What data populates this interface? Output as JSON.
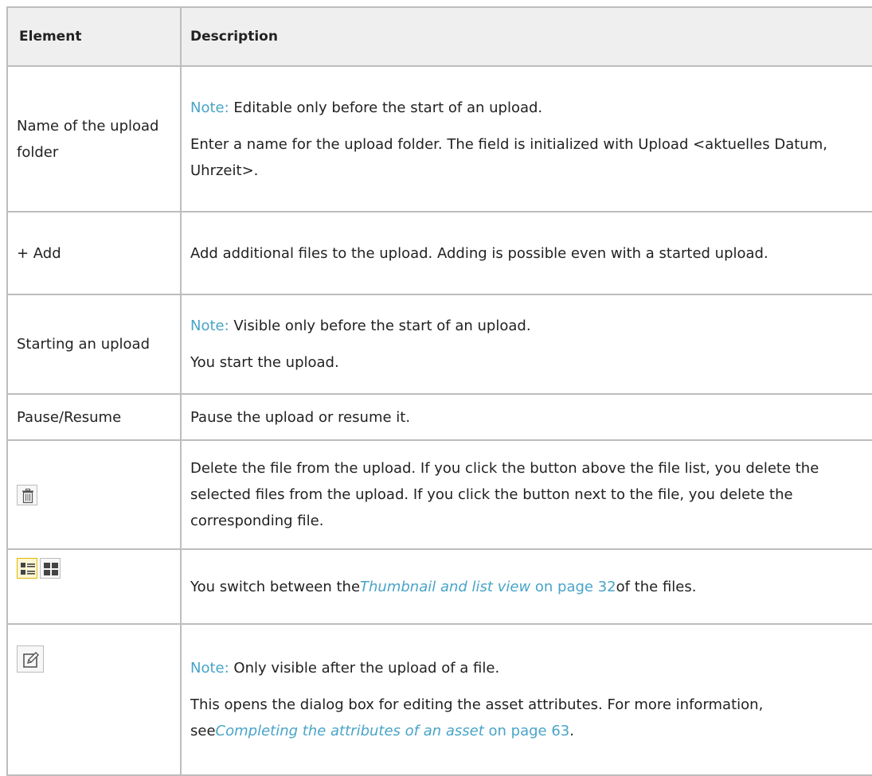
{
  "header": {
    "col_element": "Element",
    "col_description": "Description"
  },
  "rows": [
    {
      "element": "Name of the upload folder",
      "note_label": "Note:",
      "note_text": " Editable only before the start of an upload.",
      "description": "Enter a name for the upload folder. The field is initialized with Upload <aktuelles Datum, Uhrzeit>."
    },
    {
      "element": "+ Add",
      "description": "Add additional files to the upload. Adding is possible even with a started upload."
    },
    {
      "element": "Starting an upload",
      "note_label": "Note:",
      "note_text": " Visible only before the start of an upload.",
      "description": "You start the upload."
    },
    {
      "element": "Pause/Resume",
      "description": "Pause the upload or resume it."
    },
    {
      "element_icon": "trash-icon",
      "description": "Delete the file from the upload. If you click the button above the file list, you delete the selected files from the upload. If you click the button next to the file, you delete the corresponding file."
    },
    {
      "element_icons": [
        "list-view-icon",
        "thumbnail-view-icon"
      ],
      "description_before": "You switch between the",
      "link_text": "Thumbnail and list view",
      "link_page": " on page 32",
      "description_after": "of the files."
    },
    {
      "element_icon": "edit-icon",
      "note_label": "Note:",
      "note_text": " Only visible after the upload of a file.",
      "description_before": "This opens the dialog box for editing the asset attributes. For more information, see",
      "link_text": "Completing the attributes of an asset",
      "link_page": " on page 63",
      "description_after": "."
    }
  ],
  "colors": {
    "note": "#49a4c8",
    "border": "#bdbdbd",
    "header_bg": "#efefef",
    "active_icon": "#e3b600"
  }
}
